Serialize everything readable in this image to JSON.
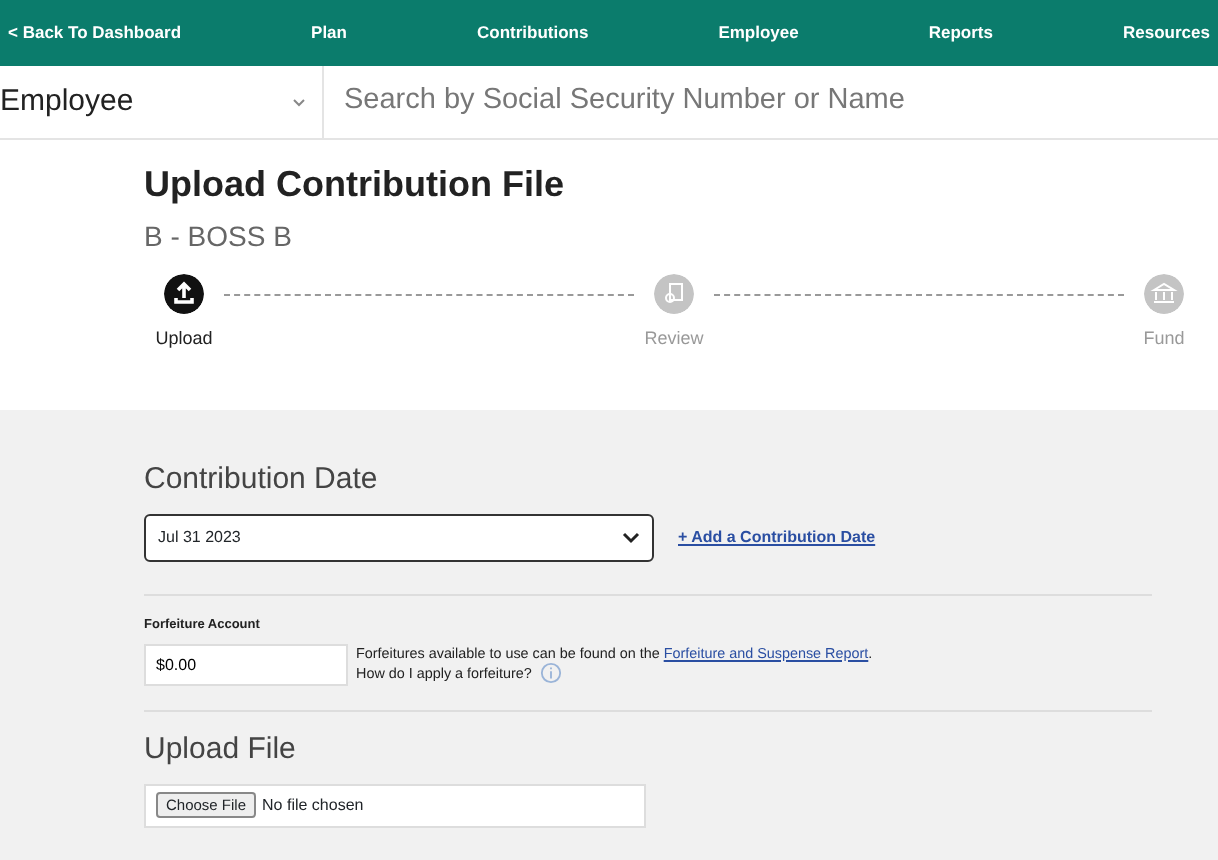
{
  "top_nav": [
    {
      "label": "< Back To Dashboard"
    },
    {
      "label": "Plan"
    },
    {
      "label": "Contributions"
    },
    {
      "label": "Employee"
    },
    {
      "label": "Reports"
    },
    {
      "label": "Resources"
    }
  ],
  "search_bar": {
    "scope": "Employee",
    "placeholder": "Search by Social Security Number or Name"
  },
  "page": {
    "title": "Upload Contribution File",
    "subtitle": "B - BOSS B"
  },
  "steps": [
    {
      "label": "Upload",
      "kind": "upload",
      "selected": true
    },
    {
      "label": "Review",
      "kind": "review",
      "selected": false
    },
    {
      "label": "Fund",
      "kind": "fund",
      "selected": false
    }
  ],
  "contribution_date": {
    "heading": "Contribution Date",
    "value": "Jul 31 2023",
    "add_link": "+ Add a Contribution Date"
  },
  "forfeiture": {
    "label": "Forfeiture Account",
    "value": "$0.00",
    "note": "Forfeitures available to use can be found on the ",
    "link": "Forfeiture and Suspense Report",
    "note_end": ".",
    "help": "How do I apply a forfeiture?"
  },
  "upload": {
    "heading": "Upload File",
    "button": "Choose File",
    "status": "No file chosen"
  }
}
